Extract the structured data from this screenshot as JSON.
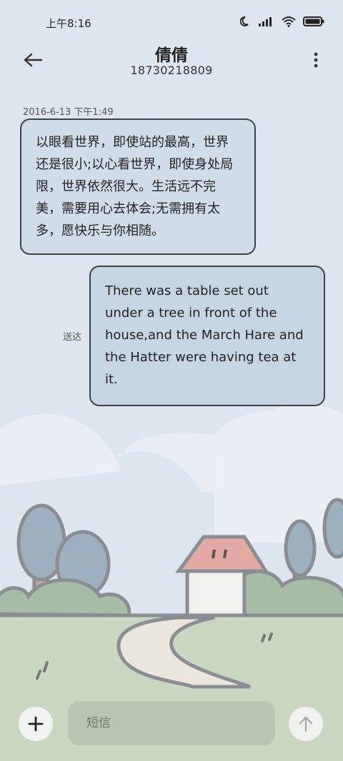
{
  "status_bar": {
    "time": "上午8:16"
  },
  "header": {
    "contact_name": "倩倩",
    "contact_number": "18730218809"
  },
  "conversation": {
    "timestamp": "2016-6-13 下午1:49",
    "incoming_message": "以眼看世界，即使站的最高，世界还是很小;以心看世界，即使身处局限，世界依然很大。生活远不完美，需要用心去体会;无需拥有太多，愿快乐与你相随。",
    "outgoing_message": "There was a table set out under a tree in front of the house,and the March Hare and the Hatter were having tea at it.",
    "outgoing_status": "送达"
  },
  "composer": {
    "placeholder": "短信"
  },
  "colors": {
    "background": "#dde5ee",
    "incoming_bubble": "#cfdce9",
    "outgoing_bubble": "#c6d5e4",
    "input_field": "#b8c6b1"
  }
}
